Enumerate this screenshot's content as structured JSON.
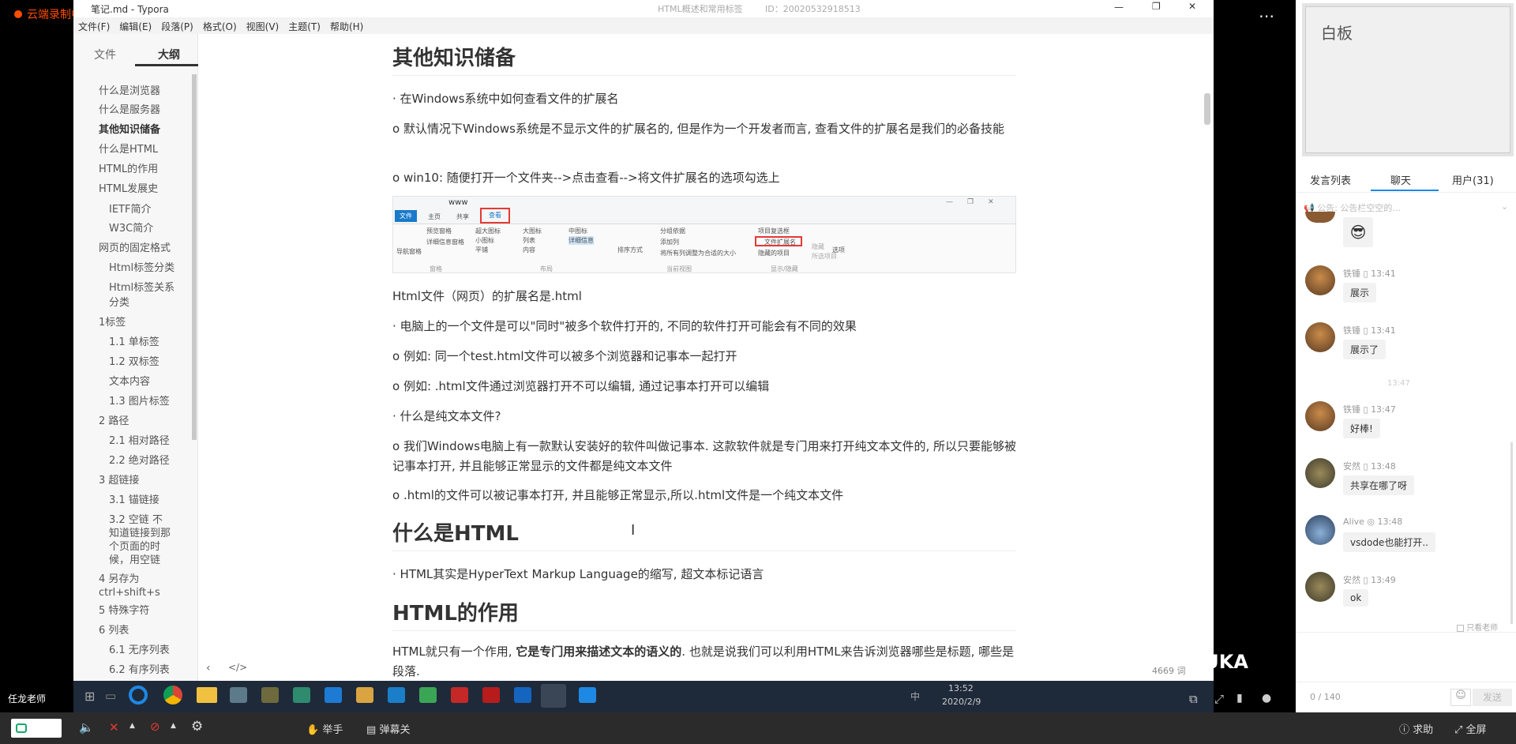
{
  "recording_label": "云端录制中",
  "window": {
    "title": "笔记.md - Typora",
    "center_title": "HTML概述和常用标签",
    "id_label": "ID：20020532918513"
  },
  "menu": [
    "文件(F)",
    "编辑(E)",
    "段落(P)",
    "格式(O)",
    "视图(V)",
    "主题(T)",
    "帮助(H)"
  ],
  "sidebar": {
    "tabs": [
      "文件",
      "大纲"
    ],
    "outline": [
      {
        "label": "什么是浏览器",
        "level": 1
      },
      {
        "label": "什么是服务器",
        "level": 1
      },
      {
        "label": "其他知识储备",
        "level": 1,
        "active": true
      },
      {
        "label": "什么是HTML",
        "level": 1
      },
      {
        "label": "HTML的作用",
        "level": 1
      },
      {
        "label": "HTML发展史",
        "level": 1
      },
      {
        "label": "IETF简介",
        "level": 2
      },
      {
        "label": "W3C简介",
        "level": 2
      },
      {
        "label": "网页的固定格式",
        "level": 1
      },
      {
        "label": "Html标签分类",
        "level": 2
      },
      {
        "label": "Html标签关系",
        "level": 2
      },
      {
        "label": "分类",
        "level": 2
      },
      {
        "label": "1标签",
        "level": 1
      },
      {
        "label": "1.1 单标签",
        "level": 2
      },
      {
        "label": "1.2 双标签",
        "level": 2
      },
      {
        "label": "文本内容",
        "level": 2
      },
      {
        "label": "1.3 图片标签",
        "level": 2
      },
      {
        "label": "2 路径",
        "level": 1
      },
      {
        "label": "2.1 相对路径",
        "level": 2
      },
      {
        "label": "2.2 绝对路径",
        "level": 2
      },
      {
        "label": "3 超链接",
        "level": 1
      },
      {
        "label": "3.1 锚链接",
        "level": 2
      },
      {
        "label": "3.2 空链 不",
        "level": 2
      },
      {
        "label": "知道链接到那",
        "level": 2
      },
      {
        "label": "个页面的时",
        "level": 2
      },
      {
        "label": "候，用空链",
        "level": 2
      },
      {
        "label": "4 另存为",
        "level": 1
      },
      {
        "label": "ctrl+shift+s",
        "level": 1
      },
      {
        "label": "5 特殊字符",
        "level": 1
      },
      {
        "label": "6 列表",
        "level": 1
      },
      {
        "label": "6.1 无序列表",
        "level": 2
      },
      {
        "label": "6.2 有序列表",
        "level": 2
      }
    ]
  },
  "doc": {
    "h_other": "其他知识储备",
    "p1": "· 在Windows系统中如何查看文件的扩展名",
    "p2": "o 默认情况下Windows系统是不显示文件的扩展名的, 但是作为一个开发者而言, 查看文件的扩展名是我们的必备技能",
    "p3": "o win10: 随便打开一个文件夹-->点击查看-->将文件扩展名的选项勾选上",
    "shot": {
      "folder": "www",
      "tabs": [
        "文件",
        "主页",
        "共享",
        "查看"
      ],
      "items": [
        "导航窗格",
        "预览窗格",
        "详细信息窗格",
        "超大图标",
        "大图标",
        "中图标",
        "小图标",
        "列表",
        "详细信息",
        "平铺",
        "内容",
        "排序方式",
        "分组依据",
        "添加列",
        "将所有列调整为合适的大小",
        "项目复选框",
        "文件扩展名",
        "隐藏的项目",
        "隐藏",
        "所选项目",
        "选项"
      ],
      "groups": [
        "窗格",
        "布局",
        "当前视图",
        "显示/隐藏"
      ]
    },
    "p4": "Html文件（网页）的扩展名是.html",
    "p5": "· 电脑上的一个文件是可以\"同时\"被多个软件打开的, 不同的软件打开可能会有不同的效果",
    "p6": "o 例如: 同一个test.html文件可以被多个浏览器和记事本一起打开",
    "p7": "o 例如: .html文件通过浏览器打开不可以编辑, 通过记事本打开可以编辑",
    "p8": "· 什么是纯文本文件?",
    "p9": "o 我们Windows电脑上有一款默认安装好的软件叫做记事本. 这款软件就是专门用来打开纯文本文件的, 所以只要能够被记事本打开, 并且能够正常显示的文件都是纯文本文件",
    "p10": "o .html的文件可以被记事本打开, 并且能够正常显示,所以.html文件是一个纯文本文件",
    "h_html": "什么是HTML",
    "p11": "· HTML其实是HyperText Markup Language的缩写, 超文本标记语言",
    "h_role": "HTML的作用",
    "p12a": "HTML就只有一个作用, ",
    "p12b": "它是专门用来描述文本的语义的",
    "p12c": ". 也就是说我们可以利用HTML来告诉浏览器哪些是标题, 哪些是段落.",
    "word_count": "4669 词"
  },
  "teacher_label": "任龙老师",
  "taskbar": {
    "time": "13:52",
    "date": "2020/2/9",
    "ime": "中"
  },
  "right": {
    "whiteboard_title": "白板",
    "tabs": [
      "发言列表",
      "聊天",
      "用户(31)"
    ],
    "notice_label": "公告:",
    "notice_placeholder": "公告栏空空的...",
    "messages": [
      {
        "name": "铁锤",
        "time": "13:41",
        "text": "展示"
      },
      {
        "name": "铁锤",
        "time": "13:41",
        "text": "展示了"
      },
      {
        "name": "铁锤",
        "time": "13:47",
        "text": "好棒!"
      },
      {
        "name": "安然",
        "time": "13:48",
        "text": "共享在哪了呀"
      },
      {
        "name": "Alive",
        "time": "13:48",
        "text": "vsdode也能打开.."
      },
      {
        "name": "安然",
        "time": "13:49",
        "text": "ok"
      }
    ],
    "divider_time": "13:47",
    "only_teacher": "只看老师",
    "char_count": "0 / 140",
    "send": "发送",
    "brand": "BUKA"
  },
  "bottom": {
    "hand": "举手",
    "danmu": "弹幕关",
    "help": "求助",
    "fullscreen": "全屏"
  }
}
